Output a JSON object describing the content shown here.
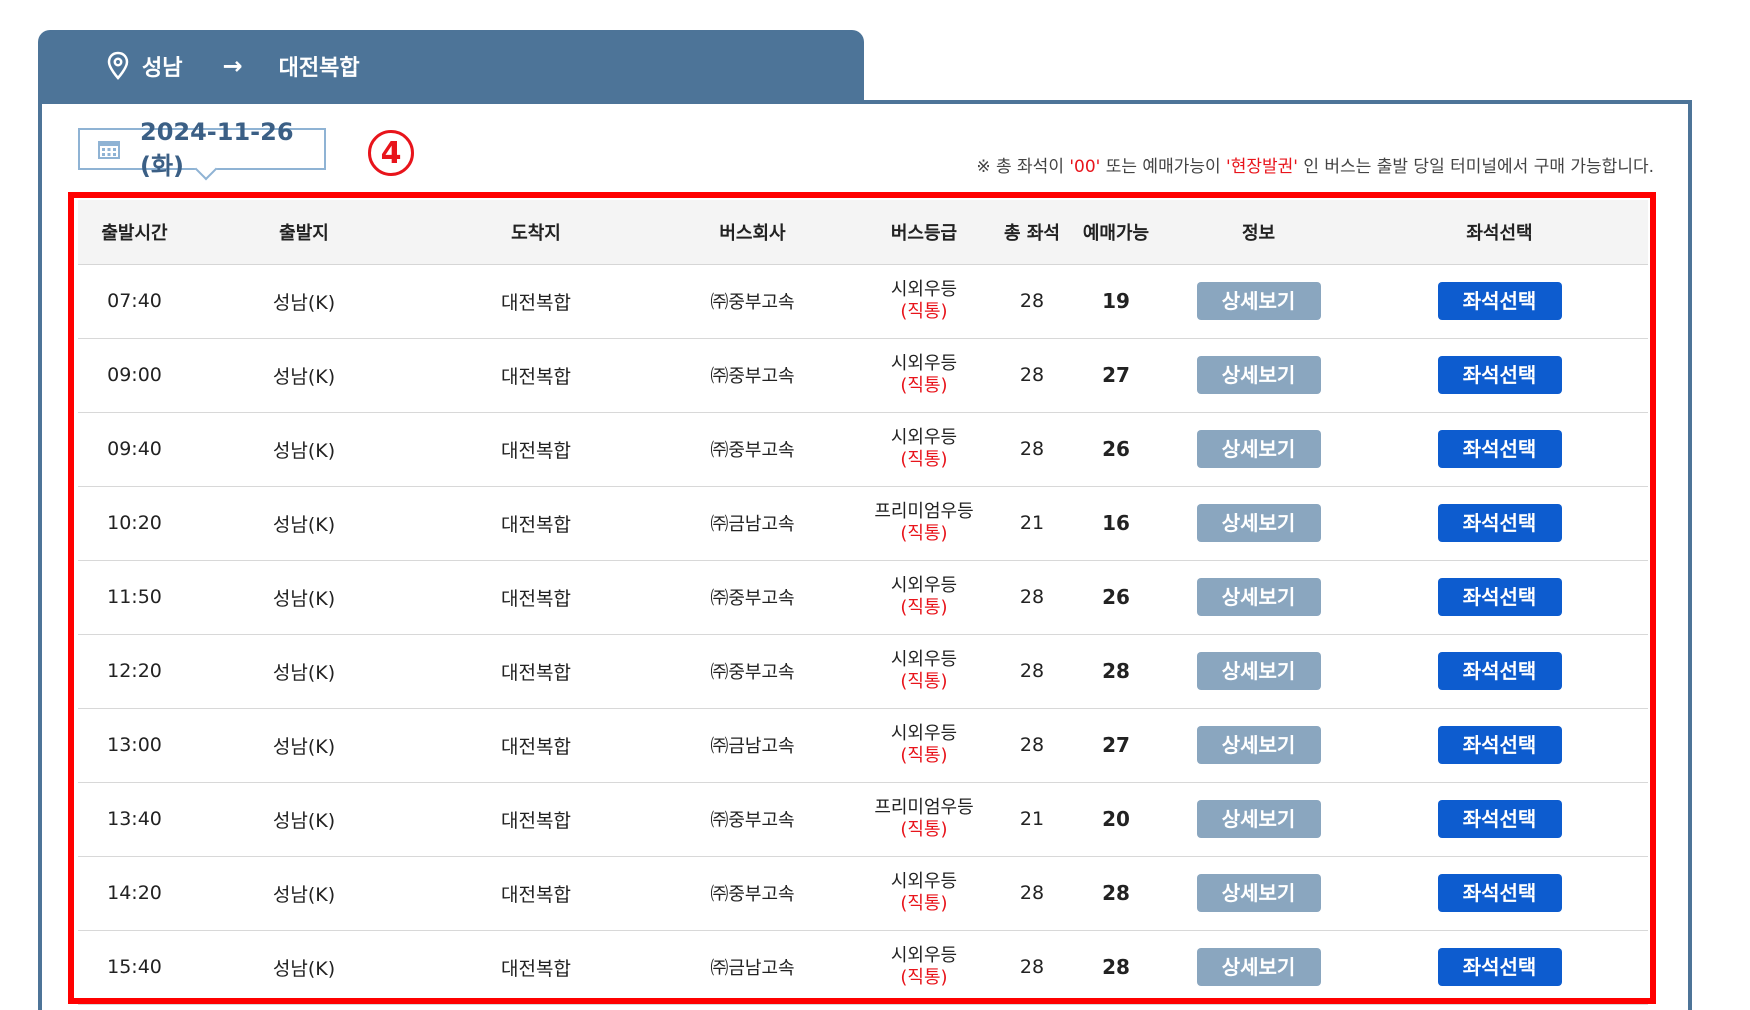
{
  "route": {
    "from": "성남",
    "to": "대전복합"
  },
  "date": "2024-11-26 (화)",
  "annotation": "4",
  "notice": {
    "part1": "※ 총 좌석이 ",
    "hl1": "'00'",
    "part2": " 또는 예매가능이 ",
    "hl2": "'현장발권'",
    "part3": " 인 버스는 출발 당일 터미널에서 구매 가능합니다."
  },
  "headers": [
    "출발시간",
    "출발지",
    "도착지",
    "버스회사",
    "버스등급",
    "총 좌석",
    "예매가능",
    "정보",
    "좌석선택"
  ],
  "button_labels": {
    "detail": "상세보기",
    "seat": "좌석선택"
  },
  "rows": [
    {
      "time": "07:40",
      "origin": "성남(K)",
      "dest": "대전복합",
      "company": "㈜중부고속",
      "grade": "시외우등",
      "grade_sub": "(직통)",
      "total": "28",
      "avail": "19"
    },
    {
      "time": "09:00",
      "origin": "성남(K)",
      "dest": "대전복합",
      "company": "㈜중부고속",
      "grade": "시외우등",
      "grade_sub": "(직통)",
      "total": "28",
      "avail": "27"
    },
    {
      "time": "09:40",
      "origin": "성남(K)",
      "dest": "대전복합",
      "company": "㈜중부고속",
      "grade": "시외우등",
      "grade_sub": "(직통)",
      "total": "28",
      "avail": "26"
    },
    {
      "time": "10:20",
      "origin": "성남(K)",
      "dest": "대전복합",
      "company": "㈜금남고속",
      "grade": "프리미엄우등",
      "grade_sub": "(직통)",
      "total": "21",
      "avail": "16"
    },
    {
      "time": "11:50",
      "origin": "성남(K)",
      "dest": "대전복합",
      "company": "㈜중부고속",
      "grade": "시외우등",
      "grade_sub": "(직통)",
      "total": "28",
      "avail": "26"
    },
    {
      "time": "12:20",
      "origin": "성남(K)",
      "dest": "대전복합",
      "company": "㈜중부고속",
      "grade": "시외우등",
      "grade_sub": "(직통)",
      "total": "28",
      "avail": "28"
    },
    {
      "time": "13:00",
      "origin": "성남(K)",
      "dest": "대전복합",
      "company": "㈜금남고속",
      "grade": "시외우등",
      "grade_sub": "(직통)",
      "total": "28",
      "avail": "27"
    },
    {
      "time": "13:40",
      "origin": "성남(K)",
      "dest": "대전복합",
      "company": "㈜중부고속",
      "grade": "프리미엄우등",
      "grade_sub": "(직통)",
      "total": "21",
      "avail": "20"
    },
    {
      "time": "14:20",
      "origin": "성남(K)",
      "dest": "대전복합",
      "company": "㈜중부고속",
      "grade": "시외우등",
      "grade_sub": "(직통)",
      "total": "28",
      "avail": "28"
    },
    {
      "time": "15:40",
      "origin": "성남(K)",
      "dest": "대전복합",
      "company": "㈜금남고속",
      "grade": "시외우등",
      "grade_sub": "(직통)",
      "total": "28",
      "avail": "28"
    }
  ],
  "colors": {
    "header_bar": "#4d7498",
    "seat_button": "#0d5ccf",
    "detail_button": "#8aa6bf",
    "highlight": "#e8141b"
  }
}
